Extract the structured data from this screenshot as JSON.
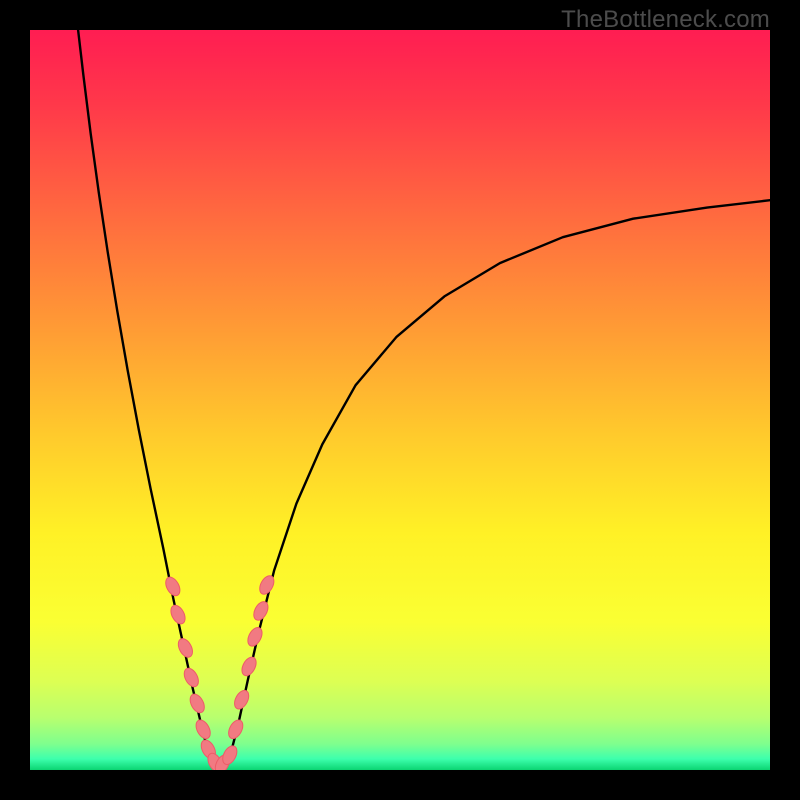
{
  "watermark": "TheBottleneck.com",
  "chart_data": {
    "type": "line",
    "title": "",
    "xlabel": "",
    "ylabel": "",
    "xlim": [
      0,
      1
    ],
    "ylim": [
      0,
      1
    ],
    "grid": false,
    "background_gradient_stops": [
      {
        "offset": 0.0,
        "color": "#ff1d52"
      },
      {
        "offset": 0.1,
        "color": "#ff384a"
      },
      {
        "offset": 0.25,
        "color": "#ff6a3f"
      },
      {
        "offset": 0.4,
        "color": "#ff9a35"
      },
      {
        "offset": 0.55,
        "color": "#ffcb2c"
      },
      {
        "offset": 0.68,
        "color": "#fff126"
      },
      {
        "offset": 0.8,
        "color": "#faff33"
      },
      {
        "offset": 0.88,
        "color": "#ddff53"
      },
      {
        "offset": 0.93,
        "color": "#b7ff6f"
      },
      {
        "offset": 0.965,
        "color": "#7eff8e"
      },
      {
        "offset": 0.985,
        "color": "#3dffad"
      },
      {
        "offset": 1.0,
        "color": "#0bd472"
      }
    ],
    "series": [
      {
        "name": "left-curve",
        "stroke": "#000000",
        "x": [
          0.065,
          0.072,
          0.082,
          0.093,
          0.105,
          0.118,
          0.132,
          0.147,
          0.163,
          0.18,
          0.194,
          0.207,
          0.22,
          0.234,
          0.245
        ],
        "y": [
          1.0,
          0.94,
          0.86,
          0.78,
          0.7,
          0.62,
          0.54,
          0.46,
          0.38,
          0.3,
          0.23,
          0.17,
          0.11,
          0.05,
          0.01
        ]
      },
      {
        "name": "right-curve",
        "stroke": "#000000",
        "x": [
          0.268,
          0.281,
          0.294,
          0.31,
          0.33,
          0.36,
          0.395,
          0.44,
          0.495,
          0.56,
          0.635,
          0.72,
          0.815,
          0.915,
          1.0
        ],
        "y": [
          0.01,
          0.06,
          0.12,
          0.19,
          0.27,
          0.36,
          0.44,
          0.52,
          0.585,
          0.64,
          0.685,
          0.72,
          0.745,
          0.76,
          0.77
        ]
      },
      {
        "name": "valley-floor",
        "stroke": "#000000",
        "x": [
          0.245,
          0.252,
          0.26,
          0.268
        ],
        "y": [
          0.01,
          0.0,
          0.0,
          0.01
        ]
      }
    ],
    "markers": {
      "name": "highlighted-points",
      "fill": "#f17a82",
      "stroke": "#ee5c68",
      "rx": 6,
      "ry": 10,
      "points": [
        {
          "x": 0.193,
          "y": 0.248
        },
        {
          "x": 0.2,
          "y": 0.21
        },
        {
          "x": 0.21,
          "y": 0.165
        },
        {
          "x": 0.218,
          "y": 0.125
        },
        {
          "x": 0.226,
          "y": 0.09
        },
        {
          "x": 0.234,
          "y": 0.055
        },
        {
          "x": 0.241,
          "y": 0.028
        },
        {
          "x": 0.25,
          "y": 0.01
        },
        {
          "x": 0.26,
          "y": 0.008
        },
        {
          "x": 0.27,
          "y": 0.02
        },
        {
          "x": 0.278,
          "y": 0.055
        },
        {
          "x": 0.286,
          "y": 0.095
        },
        {
          "x": 0.296,
          "y": 0.14
        },
        {
          "x": 0.304,
          "y": 0.18
        },
        {
          "x": 0.312,
          "y": 0.215
        },
        {
          "x": 0.32,
          "y": 0.25
        }
      ]
    }
  }
}
